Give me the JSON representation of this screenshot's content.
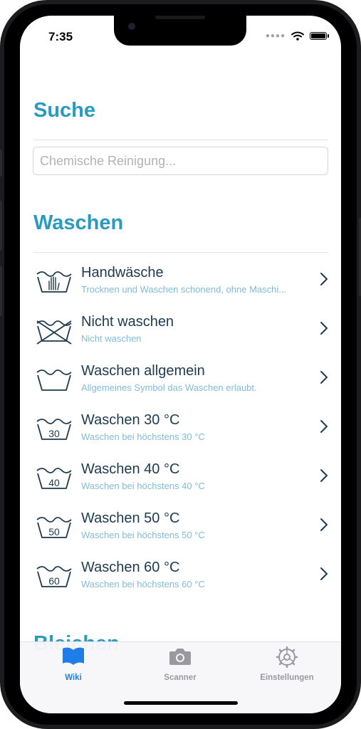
{
  "status": {
    "time": "7:35"
  },
  "search": {
    "title": "Suche",
    "placeholder": "Chemische Reinigung..."
  },
  "washing": {
    "title": "Waschen",
    "items": [
      {
        "icon": "hand-wash-icon",
        "title": "Handwäsche",
        "subtitle": "Trocknen und Waschen schonend, ohne Maschi..."
      },
      {
        "icon": "no-wash-icon",
        "title": "Nicht waschen",
        "subtitle": "Nicht waschen"
      },
      {
        "icon": "wash-icon",
        "title": "Waschen allgemein",
        "subtitle": "Allgemeines Symbol das Waschen erlaubt."
      },
      {
        "icon": "wash-30-icon",
        "title": "Waschen 30 °C",
        "subtitle": "Waschen bei höchstens 30 °C",
        "temp": "30"
      },
      {
        "icon": "wash-40-icon",
        "title": "Waschen 40 °C",
        "subtitle": "Waschen bei höchstens 40 °C",
        "temp": "40"
      },
      {
        "icon": "wash-50-icon",
        "title": "Waschen 50 °C",
        "subtitle": "Waschen bei höchstens 50 °C",
        "temp": "50"
      },
      {
        "icon": "wash-60-icon",
        "title": "Waschen 60 °C",
        "subtitle": "Waschen bei höchstens 60 °C",
        "temp": "60"
      }
    ]
  },
  "next_section": {
    "title": "Bleichen"
  },
  "tabs": [
    {
      "label": "Wiki",
      "icon": "book-icon",
      "active": true
    },
    {
      "label": "Scanner",
      "icon": "camera-icon",
      "active": false
    },
    {
      "label": "Einstellungen",
      "icon": "gear-icon",
      "active": false
    }
  ],
  "colors": {
    "accent": "#2a9bc0",
    "title_text": "#1d3a4f",
    "subtitle_text": "#80bcd8",
    "tab_active": "#1e7de6",
    "tab_inactive": "#9a9a9e"
  }
}
